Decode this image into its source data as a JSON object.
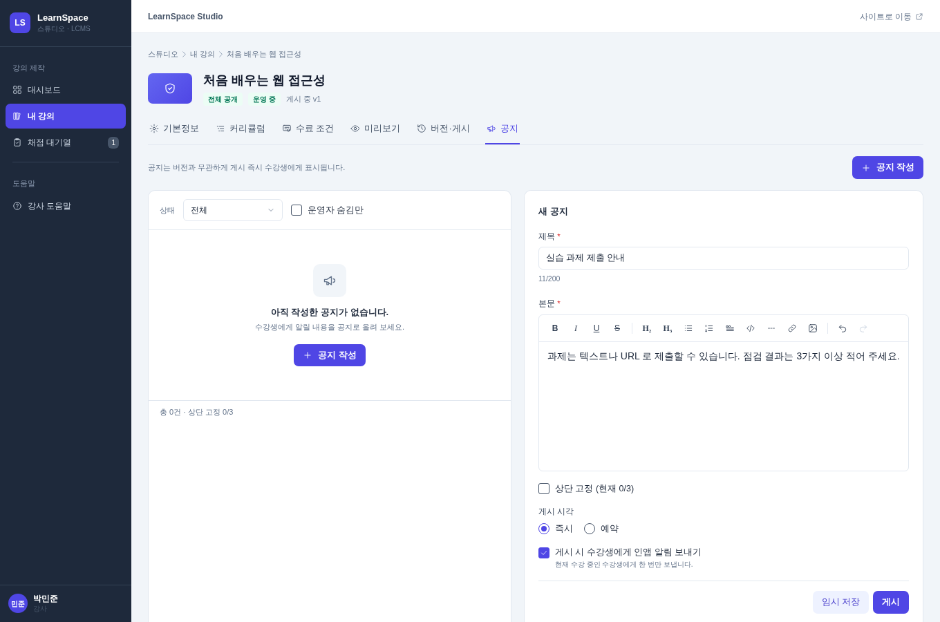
{
  "sidebar": {
    "brand": {
      "logo": "LS",
      "name": "LearnSpace",
      "subtitle": "스튜디오 · LCMS"
    },
    "sections": [
      {
        "label": "강의 제작",
        "items": [
          {
            "label": "대시보드",
            "selected": false
          },
          {
            "label": "내 강의",
            "selected": true
          },
          {
            "label": "채점 대기열",
            "selected": false,
            "badge": "1"
          }
        ]
      },
      {
        "label": "도움말",
        "items": [
          {
            "label": "강사 도움말",
            "selected": false
          }
        ]
      }
    ],
    "user": {
      "initials": "민준",
      "name": "박민준",
      "role": "강사"
    }
  },
  "topbar": {
    "title": "LearnSpace Studio",
    "link": "사이트로 이동"
  },
  "breadcrumb": [
    "스튜디오",
    "내 강의",
    "처음 배우는 웹 접근성"
  ],
  "course": {
    "title": "처음 배우는 웹 접근성",
    "tags": [
      "전체 공개",
      "운영 중"
    ],
    "status": "게시 중 v1"
  },
  "tabs": [
    {
      "label": "기본정보",
      "selected": false
    },
    {
      "label": "커리큘럼",
      "selected": false
    },
    {
      "label": "수료 조건",
      "selected": false
    },
    {
      "label": "미리보기",
      "selected": false
    },
    {
      "label": "버전·게시",
      "selected": false
    },
    {
      "label": "공지",
      "selected": true
    }
  ],
  "hint": "공지는 버전과 무관하게 게시 즉시 수강생에게 표시됩니다.",
  "create_button": "공지 작성",
  "filter": {
    "label": "상태",
    "value": "전체",
    "checkbox": {
      "label": "운영자 숨김만",
      "checked": false
    }
  },
  "empty": {
    "title": "아직 작성한 공지가 없습니다.",
    "text": "수강생에게 알릴 내용을 공지로 올려 보세요.",
    "button": "공지 작성"
  },
  "list_footer": "총 0건 · 상단 고정 0/3",
  "form": {
    "title": "새 공지",
    "title_label": "제목",
    "required": "*",
    "title_value": "실습 과제 제출 안내",
    "counter": "11/200",
    "body_label": "본문",
    "toolbar": [
      {
        "glyph": "B",
        "disabled": false
      },
      {
        "glyph": "I",
        "disabled": false
      },
      {
        "glyph": "U",
        "disabled": false
      },
      {
        "glyph": "S",
        "disabled": false
      },
      {
        "glyph": "H₂",
        "disabled": false
      },
      {
        "glyph": "H₃",
        "disabled": false
      },
      {
        "disabled": false
      },
      {
        "disabled": false
      },
      {
        "disabled": false
      },
      {
        "disabled": false
      },
      {
        "disabled": false
      },
      {
        "disabled": false
      },
      {
        "disabled": false
      },
      {
        "disabled": false
      },
      {
        "disabled": true
      }
    ],
    "body": "과제는 텍스트나 URL 로 제출할 수 있습니다. 점검 결과는 3가지 이상 적어 주세요.",
    "pin": {
      "label": "상단 고정 (현재 0/3)",
      "checked": false
    },
    "publish": {
      "label": "게시 시각",
      "options": [
        {
          "label": "즉시",
          "selected": true
        },
        {
          "label": "예약",
          "selected": false
        }
      ]
    },
    "notify": {
      "label": "게시 시 수강생에게 인앱 알림 보내기",
      "help": "현재 수강 중인 수강생에게 한 번만 보냅니다.",
      "checked": true
    },
    "buttons": [
      {
        "kind": "secondary",
        "label": "임시 저장"
      },
      {
        "kind": "primary",
        "label": "게시"
      }
    ]
  }
}
